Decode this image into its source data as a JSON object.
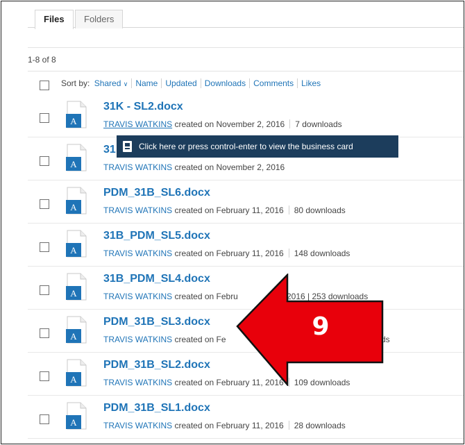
{
  "tabs": [
    {
      "label": "Files",
      "active": true
    },
    {
      "label": "Folders",
      "active": false
    }
  ],
  "count": "1-8 of 8",
  "sort": {
    "label": "Sort by:",
    "options": [
      "Shared",
      "Name",
      "Updated",
      "Downloads",
      "Comments",
      "Likes"
    ],
    "chevron": "∨"
  },
  "tooltip": {
    "text": "Click here or press control-enter to view the business card",
    "icon": "business-card-icon"
  },
  "files": [
    {
      "name": "31K - SL2.docx",
      "author": "TRAVIS WATKINS",
      "created_text": "created on November 2, 2016",
      "downloads": "7 downloads"
    },
    {
      "name": "31",
      "author": "TRAVIS WATKINS",
      "created_text": "created on November 2, 2016",
      "downloads": ""
    },
    {
      "name": "PDM_31B_SL6.docx",
      "author": "TRAVIS WATKINS",
      "created_text": "created on February 11, 2016",
      "downloads": "80 downloads"
    },
    {
      "name": "31B_PDM_SL5.docx",
      "author": "TRAVIS WATKINS",
      "created_text": "created on February 11, 2016",
      "downloads": "148 downloads"
    },
    {
      "name": "31B_PDM_SL4.docx",
      "author": "TRAVIS WATKINS",
      "created_text": "created on Febru",
      "downloads": "2016 | 253 downloads"
    },
    {
      "name": "PDM_31B_SL3.docx",
      "author": "TRAVIS WATKINS",
      "created_text": "created on Fe",
      "downloads": "ds"
    },
    {
      "name": "PDM_31B_SL2.docx",
      "author": "TRAVIS WATKINS",
      "created_text": "created on February 11, 2016",
      "downloads": "109 downloads"
    },
    {
      "name": "PDM_31B_SL1.docx",
      "author": "TRAVIS WATKINS",
      "created_text": "created on February 11, 2016",
      "downloads": "28 downloads"
    }
  ],
  "annotation": {
    "number": "9",
    "color": "#e8000b"
  },
  "colors": {
    "link": "#1f74b7",
    "tooltip_bg": "#1c3d5c",
    "doc_icon": "#1f74b7"
  }
}
